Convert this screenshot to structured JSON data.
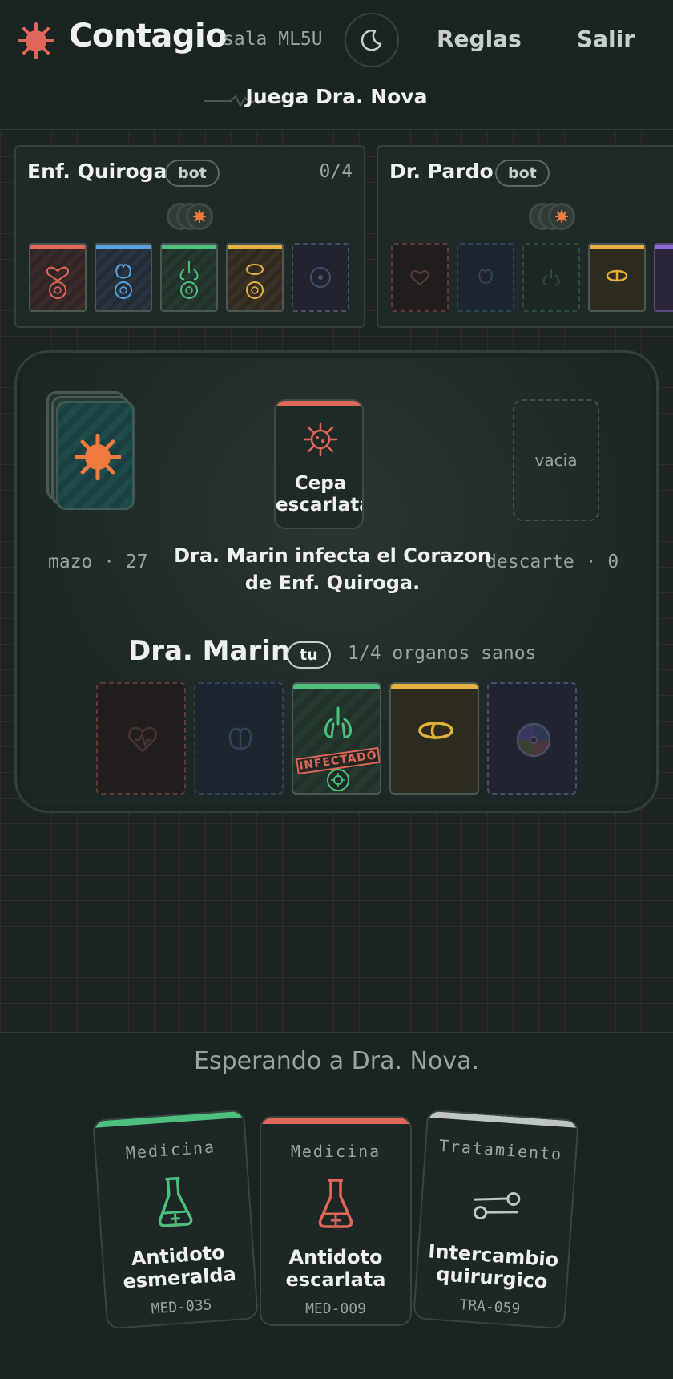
{
  "header": {
    "brand": "Contagio",
    "room": "sala ML5U",
    "rules_label": "Reglas",
    "exit_label": "Salir",
    "turn_text": "Juega Dra. Nova"
  },
  "opponents": [
    {
      "name": "Enf. Quiroga",
      "badge": "bot",
      "count": "0/4"
    },
    {
      "name": "Dr. Pardo",
      "badge": "bot",
      "count": ""
    }
  ],
  "table": {
    "deck_label": "mazo · 27",
    "discard_label": "descarte · 0",
    "discard_empty": "vacia",
    "last_card": "Cepa escarlata",
    "log": "Dra. Marin infecta el Corazon de Enf. Quiroga."
  },
  "me": {
    "name": "Dra. Marin",
    "badge": "tu",
    "status": "1/4 organos sanos",
    "infected_stamp": "INFECTADO"
  },
  "hand": {
    "waiting": "Esperando a Dra. Nova.",
    "cards": [
      {
        "type": "Medicina",
        "name": "Antidoto esmeralda",
        "code": "MED-035",
        "color": "#4ec07e"
      },
      {
        "type": "Medicina",
        "name": "Antidoto escarlata",
        "code": "MED-009",
        "color": "#e0685a"
      },
      {
        "type": "Tratamiento",
        "name": "Intercambio quirurgico",
        "code": "TRA-059",
        "color": "#c0c6c2"
      }
    ]
  },
  "colors": {
    "red": "#e0685a",
    "blue": "#5aa3e0",
    "green": "#4ec07e",
    "yellow": "#e3b23c",
    "purple": "#8c6bd6",
    "accent": "#ef7a3e"
  }
}
